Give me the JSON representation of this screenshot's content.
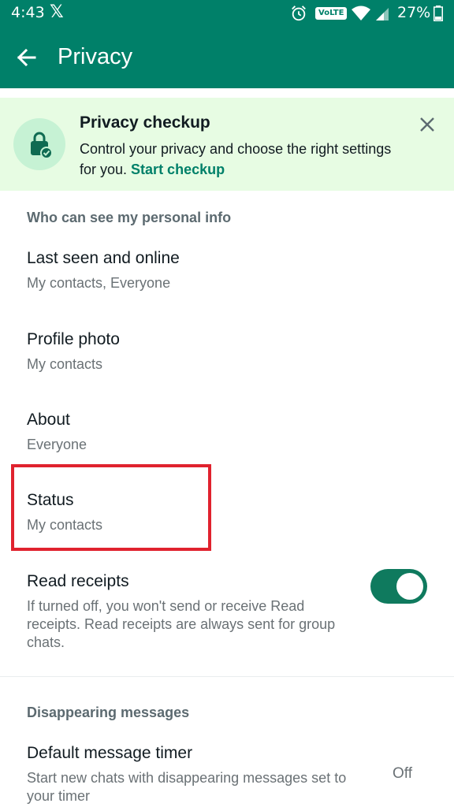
{
  "status_bar": {
    "time": "4:43",
    "x_logo": "𝕏",
    "volte": "VoLTE",
    "battery": "27%"
  },
  "app_bar": {
    "title": "Privacy",
    "back_icon": "arrow-left-icon"
  },
  "checkup_banner": {
    "title": "Privacy checkup",
    "description": "Control your privacy and choose the right settings for you.",
    "link": "Start checkup",
    "icon": "lock-check-icon",
    "close_icon": "close-icon"
  },
  "personal_info": {
    "header": "Who can see my personal info",
    "items": [
      {
        "title": "Last seen and online",
        "subtitle": "My contacts, Everyone"
      },
      {
        "title": "Profile photo",
        "subtitle": "My contacts"
      },
      {
        "title": "About",
        "subtitle": "Everyone"
      },
      {
        "title": "Status",
        "subtitle": "My contacts"
      }
    ]
  },
  "read_receipts": {
    "title": "Read receipts",
    "subtitle": "If turned off, you won't send or receive Read receipts. Read receipts are always sent for group chats.",
    "enabled": true
  },
  "disappearing": {
    "header": "Disappearing messages",
    "timer_title": "Default message timer",
    "timer_subtitle": "Start new chats with disappearing messages set to your timer",
    "timer_value": "Off"
  },
  "colors": {
    "brand": "#008069",
    "banner_bg": "#e7fce3",
    "highlight": "#e0222e",
    "toggle_on": "#0f7a5e"
  }
}
